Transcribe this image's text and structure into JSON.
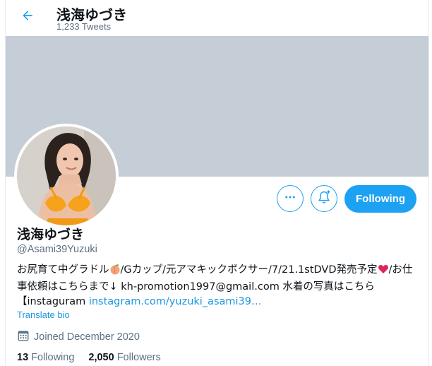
{
  "header": {
    "title": "浅海ゆづき",
    "tweet_count": "1,233 Tweets"
  },
  "colors": {
    "accent": "#1da1f2",
    "banner": "#c5ced6",
    "secondary_text": "#5b7083"
  },
  "icons": {
    "back": "back-arrow-icon",
    "more": "more-options-icon",
    "notify": "notification-bell-plus-icon",
    "calendar": "calendar-icon"
  },
  "actions": {
    "follow_label": "Following"
  },
  "profile": {
    "display_name": "浅海ゆづき",
    "handle": "@Asami39Yuzuki",
    "bio_part1": "お尻育て中グラドル",
    "bio_part2": "/Gカップ/元アマキックボクサー/7/21.1stDVD発売予定",
    "bio_part3": "/お仕事依頼はこちらまで↓ kh-promotion1997@gmail.com 水着の写真はこちら【instaguram ",
    "bio_link": "instagram.com/yuzuki_asami39…",
    "translate_label": "Translate bio",
    "joined": "Joined December 2020"
  },
  "stats": {
    "following_count": "13",
    "following_label": "Following",
    "followers_count": "2,050",
    "followers_label": "Followers"
  }
}
